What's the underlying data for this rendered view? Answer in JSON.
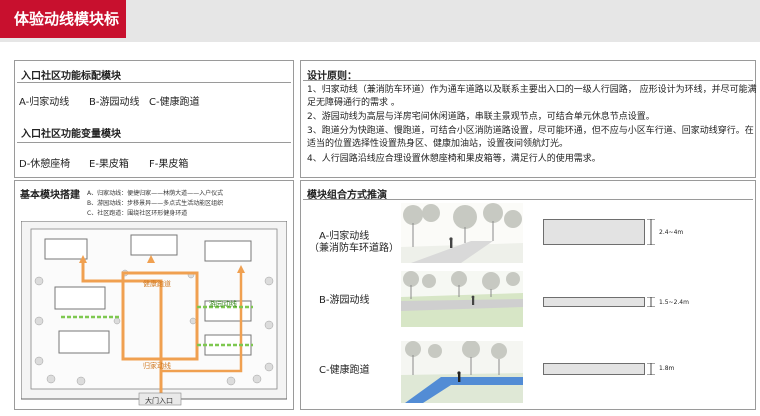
{
  "header": {
    "title": "体验动线模块标准"
  },
  "left": {
    "function_module_title": "入口社区功能标配模块",
    "function_modules": [
      "A-归家动线",
      "B-游园动线",
      "C-健康跑道"
    ],
    "variable_module_title": "入口社区功能变量模块",
    "variable_modules": [
      "D-休憩座椅",
      "E-果皮箱",
      "F-果皮箱"
    ],
    "basic_title": "基本模块搭建",
    "basic_notes": [
      "A、归家动线：便捷归家——林荫大道——入户仪式",
      "B、游园动线：步移景异——多点式生活动能区组织",
      "C、社区跑道：围绕社区环形健身环道"
    ],
    "plan_labels": {
      "health_track": "健康跑道",
      "garden_route": "游园动线",
      "home_route": "归家动线",
      "gate": "大门入口"
    }
  },
  "principles": {
    "title": "设计原则：",
    "items": [
      "1、归家动线（兼消防车环道）作为通车道路以及联系主要出入口的一级人行园路，  应形设计为环线，并尽可能满足无障碍通行的需求 。",
      "2、游园动线为高层与洋房宅间休闲道路，串联主景观节点，可结合单元休息节点设置。",
      "3、跑道分为快跑道、慢跑道，可结合小区消防道路设置，尽可能环通，但不应与小区车行道、回家动线穿行。在适当的位置选择性设置热身区、健康加油站，设置夜间领航灯光。",
      "4、人行园路沿线应合理设置休憩座椅和果皮箱等，满足行人的使用需求。"
    ]
  },
  "combination": {
    "title": "模块组合方式推演",
    "rows": [
      {
        "label": "A-归家动线",
        "sublabel": "（兼消防车环道路）",
        "dimension": "2.4~4m"
      },
      {
        "label": "B-游园动线",
        "sublabel": "",
        "dimension": "1.5~2.4m"
      },
      {
        "label": "C-健康跑道",
        "sublabel": "",
        "dimension": "1.8m"
      }
    ]
  },
  "colors": {
    "accent": "#c8102e",
    "home_route": "#f0a050",
    "garden_route": "#7ec850",
    "track": "#3a7bd5"
  }
}
